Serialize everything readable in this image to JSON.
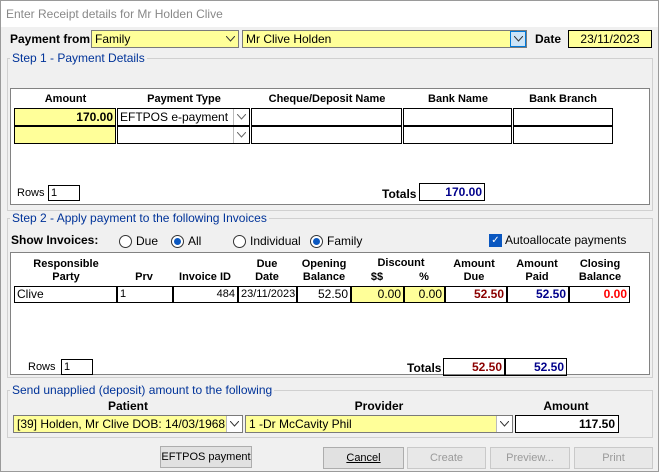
{
  "window": {
    "title": "Enter Receipt details for Mr  Holden  Clive"
  },
  "header": {
    "payment_from_label": "Payment from",
    "payment_from_value": "Family",
    "payer_value": "Mr Clive  Holden",
    "date_label": "Date",
    "date_value": "23/11/2023"
  },
  "step1": {
    "title": "Step 1 - Payment Details",
    "columns": [
      "Amount",
      "Payment Type",
      "Cheque/Deposit Name",
      "Bank Name",
      "Bank Branch"
    ],
    "rows": [
      {
        "amount": "170.00",
        "payment_type": "EFTPOS e-payment",
        "cheque_name": "",
        "bank_name": "",
        "bank_branch": ""
      },
      {
        "amount": "",
        "payment_type": "",
        "cheque_name": "",
        "bank_name": "",
        "bank_branch": ""
      }
    ],
    "rows_label": "Rows",
    "rows_count": "1",
    "totals_label": "Totals",
    "totals_value": "170.00"
  },
  "step2": {
    "title": "Step 2 - Apply payment to the following Invoices",
    "show_invoices_label": "Show Invoices:",
    "radio_due": "Due",
    "radio_all": "All",
    "radio_individual": "Individual",
    "radio_family": "Family",
    "autoallocate_label": "Autoallocate payments",
    "columns": {
      "responsible": "Responsible\nParty",
      "prv": "Prv",
      "invoice_id": "Invoice ID",
      "due_date": "Due\nDate",
      "opening_balance": "Opening\nBalance",
      "discount": "Discount",
      "discount_dollar": "$$",
      "discount_pct": "%",
      "amount_due": "Amount\nDue",
      "amount_paid": "Amount\nPaid",
      "closing_balance": "Closing\nBalance"
    },
    "rows": [
      {
        "party": "Clive",
        "prv": "1",
        "invoice_id": "484",
        "due_date": "23/11/2023",
        "opening_balance": "52.50",
        "discount_dollar": "0.00",
        "discount_pct": "0.00",
        "amount_due": "52.50",
        "amount_paid": "52.50",
        "closing_balance": "0.00"
      }
    ],
    "rows_label": "Rows",
    "rows_count": "1",
    "totals_label": "Totals",
    "total_due": "52.50",
    "total_paid": "52.50"
  },
  "unapplied": {
    "title": "Send unapplied (deposit) amount to the following",
    "patient_label": "Patient",
    "provider_label": "Provider",
    "amount_label": "Amount",
    "patient_value": "[39] Holden, Mr Clive DOB: 14/03/1968",
    "provider_value": "1 -Dr McCavity Phil",
    "amount_value": "117.50"
  },
  "buttons": {
    "eftpos": "EFTPOS payment",
    "cancel": "Cancel",
    "create": "Create",
    "preview": "Preview...",
    "print": "Print"
  },
  "colors": {
    "accent": "#003399",
    "field_yellow": "#ffff99",
    "amount_due_red": "#8b0000",
    "amount_paid_blue": "#00008b",
    "closing_red": "#ff0000"
  }
}
